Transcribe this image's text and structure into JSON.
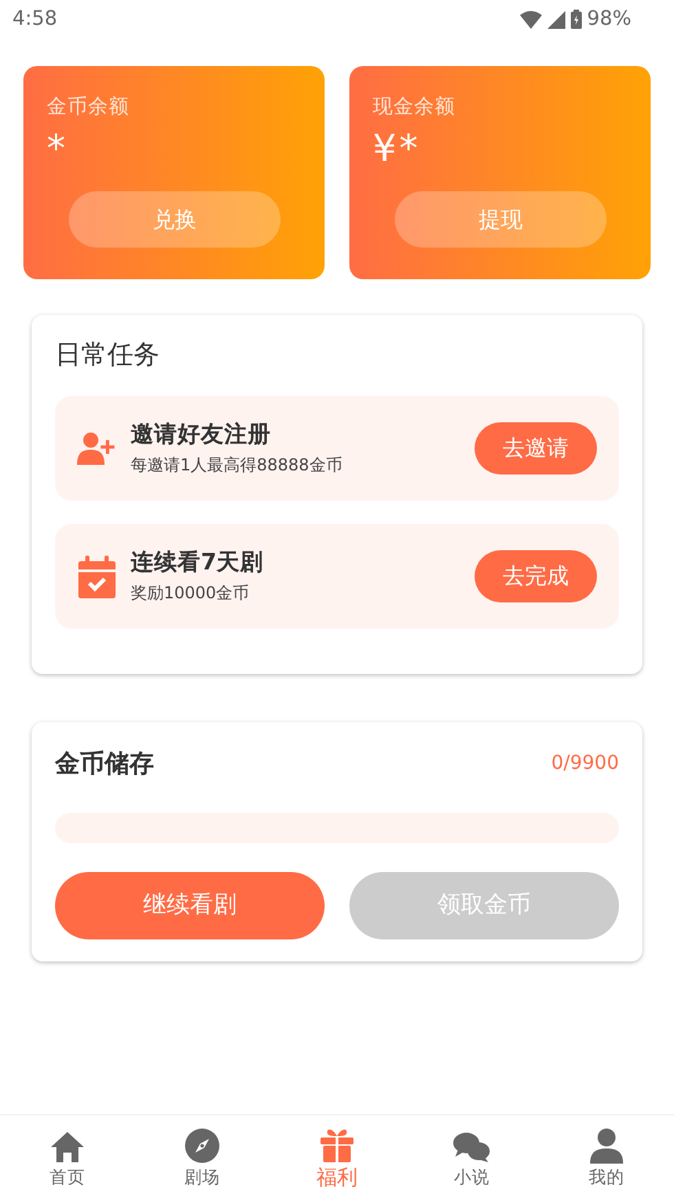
{
  "status_bar": {
    "time": "4:58",
    "battery": "98%"
  },
  "balances": [
    {
      "label": "金币余额",
      "value": "*",
      "button": "兑换"
    },
    {
      "label": "现金余额",
      "currency": "¥",
      "value": "*",
      "button": "提现"
    }
  ],
  "daily_tasks": {
    "title": "日常任务",
    "tasks": [
      {
        "kind": "invite",
        "title": "邀请好友注册",
        "description": "每邀请1人最高得88888金币",
        "button": "去邀请"
      },
      {
        "kind": "calendar",
        "title": "连续看7天剧",
        "description": "奖励10000金币",
        "button": "去完成"
      }
    ]
  },
  "coin_storage": {
    "title": "金币储存",
    "progress": "0/9900",
    "level": 0,
    "buttons": [
      {
        "label": "继续看剧",
        "disabled": false
      },
      {
        "label": "领取金币",
        "disabled": true
      }
    ]
  },
  "tab_bar": [
    {
      "kind": "home",
      "label": "首页",
      "selected": false
    },
    {
      "kind": "compass",
      "label": "剧场",
      "selected": false
    },
    {
      "kind": "gift",
      "label": "福利",
      "selected": true
    },
    {
      "kind": "chat",
      "label": "小说",
      "selected": false
    },
    {
      "kind": "user",
      "label": "我的",
      "selected": false
    }
  ]
}
